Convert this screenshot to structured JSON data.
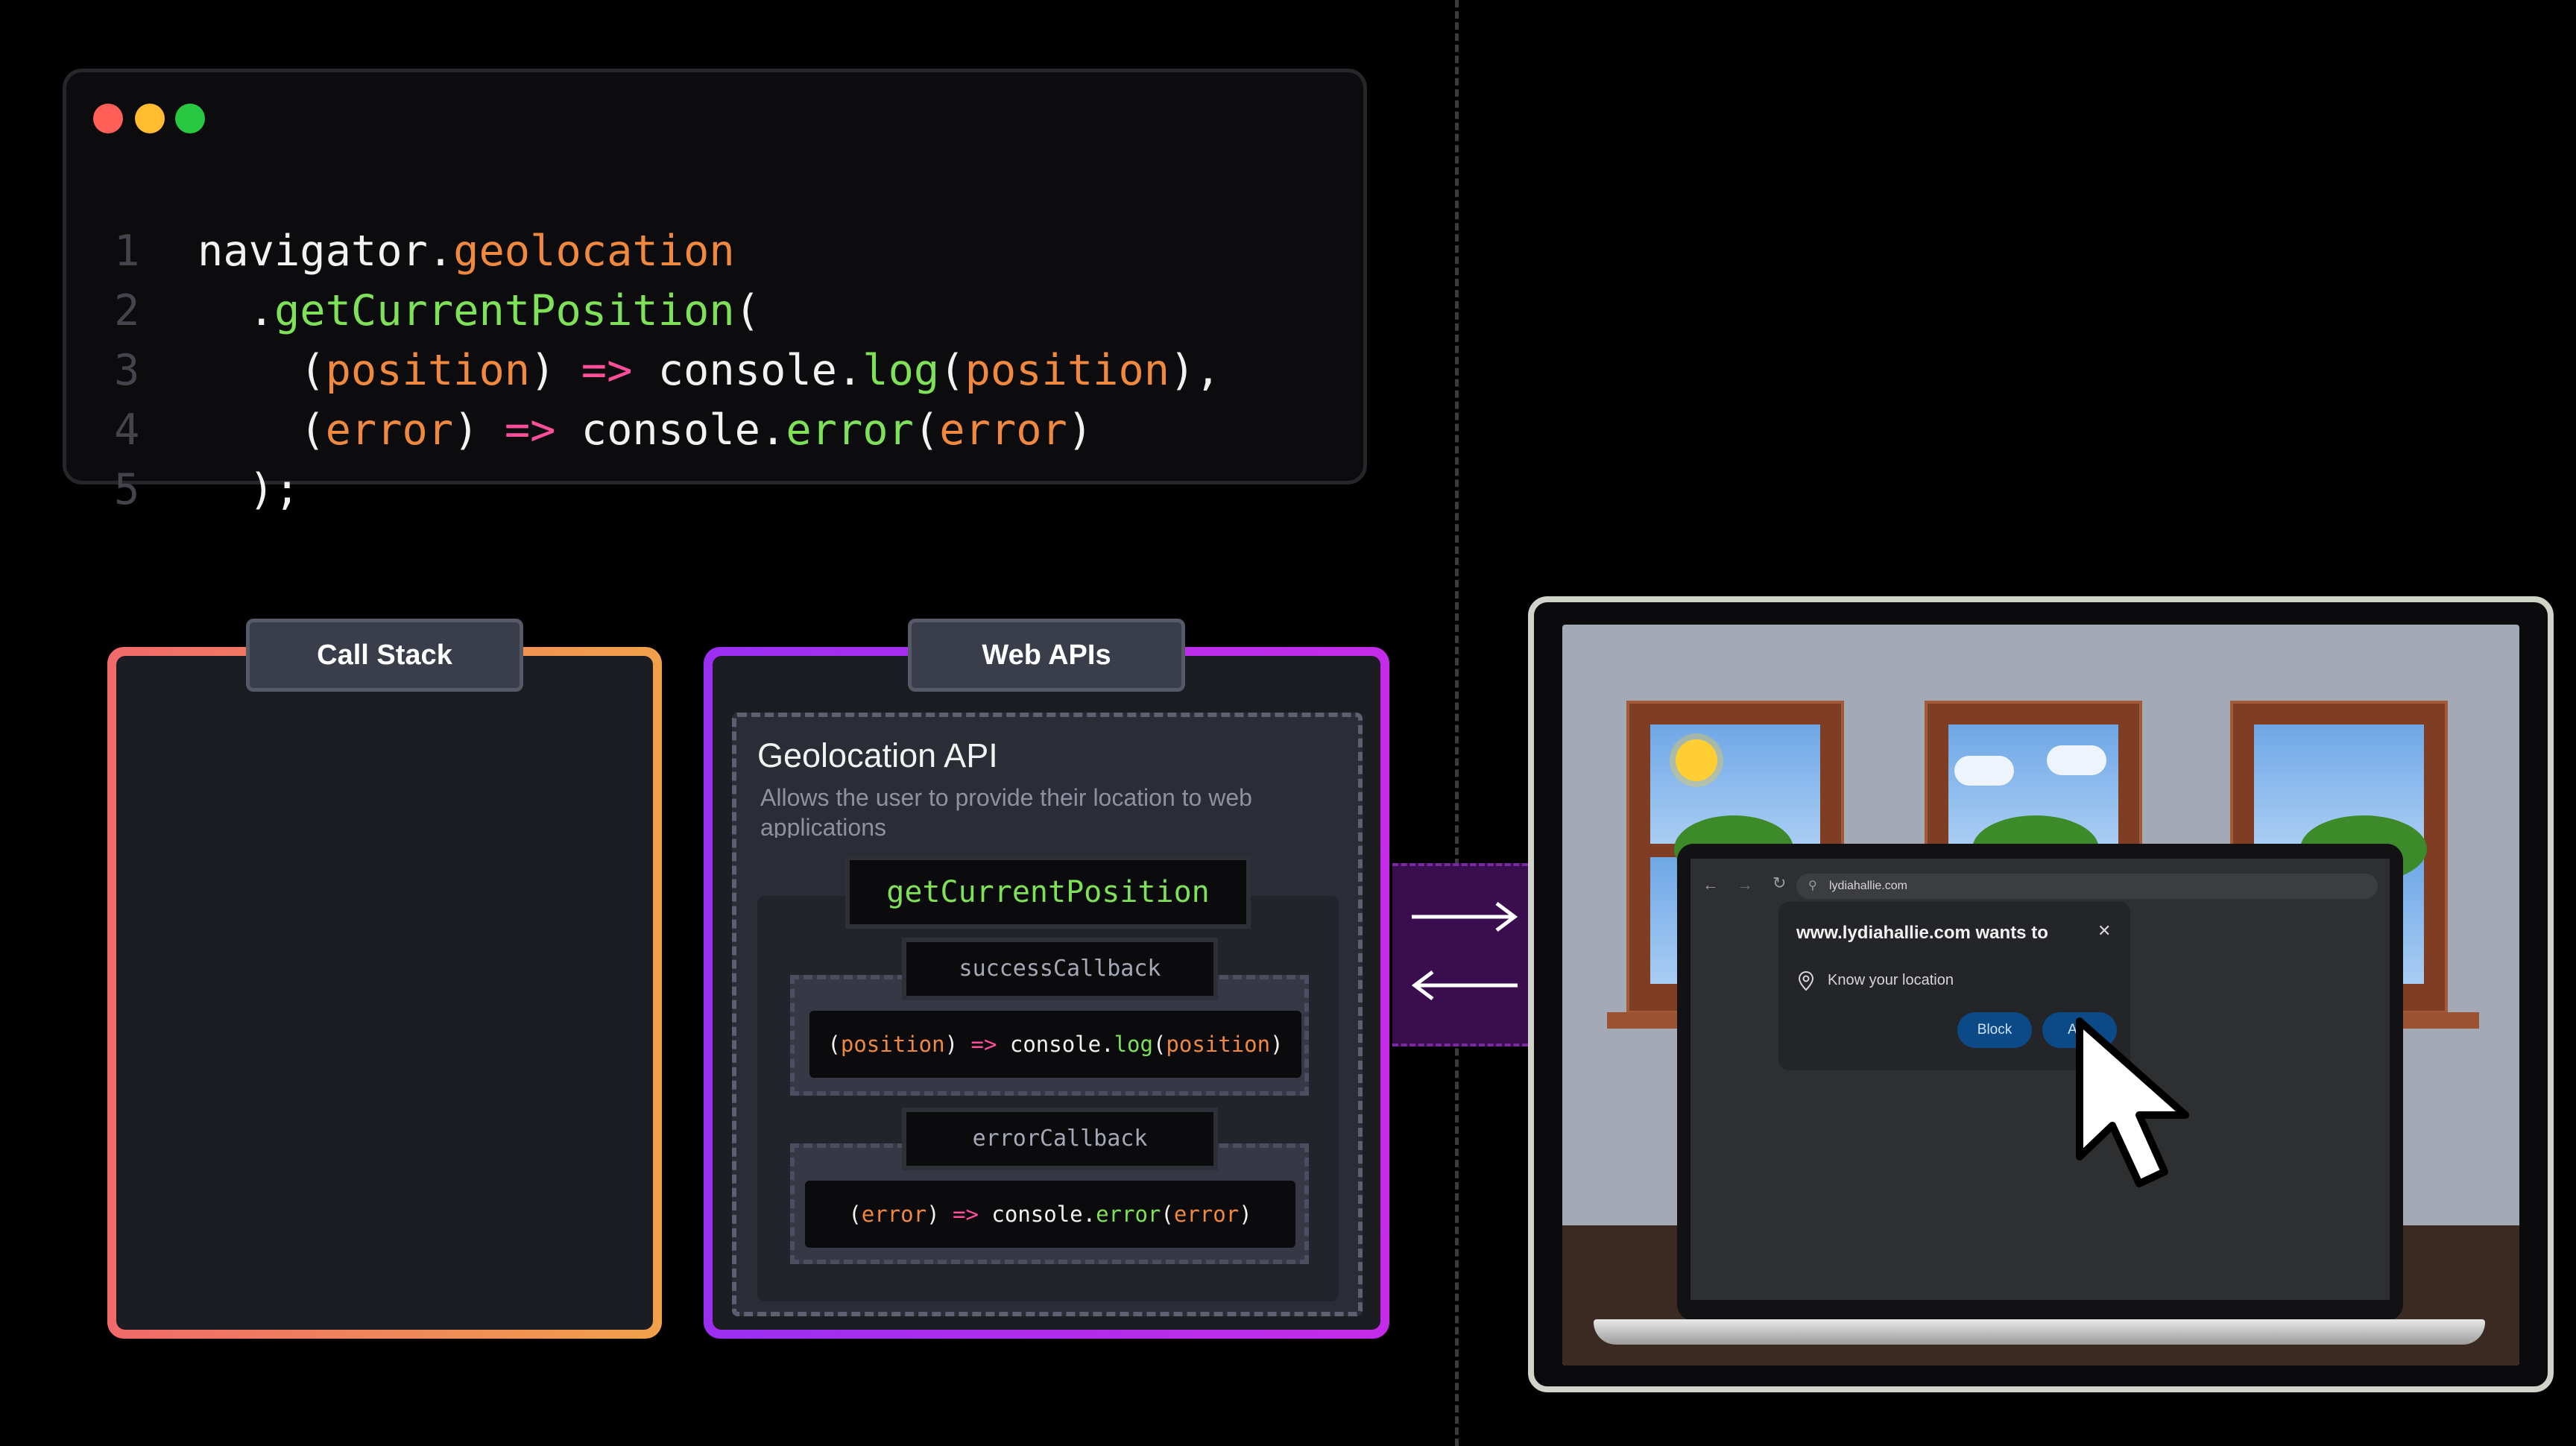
{
  "editor": {
    "lines": [
      {
        "num": "1",
        "parts": [
          {
            "t": "navigator.",
            "c": "cW"
          },
          {
            "t": "geolocation",
            "c": "cO"
          }
        ]
      },
      {
        "num": "2",
        "parts": [
          {
            "t": "  .",
            "c": "cW"
          },
          {
            "t": "getCurrentPosition",
            "c": "cG"
          },
          {
            "t": "(",
            "c": "cW"
          }
        ]
      },
      {
        "num": "3",
        "parts": [
          {
            "t": "    (",
            "c": "cW"
          },
          {
            "t": "position",
            "c": "cO"
          },
          {
            "t": ") ",
            "c": "cW"
          },
          {
            "t": "=>",
            "c": "cP"
          },
          {
            "t": " console.",
            "c": "cW"
          },
          {
            "t": "log",
            "c": "cG"
          },
          {
            "t": "(",
            "c": "cW"
          },
          {
            "t": "position",
            "c": "cO"
          },
          {
            "t": "),",
            "c": "cW"
          }
        ]
      },
      {
        "num": "4",
        "parts": [
          {
            "t": "    (",
            "c": "cW"
          },
          {
            "t": "error",
            "c": "cO"
          },
          {
            "t": ") ",
            "c": "cW"
          },
          {
            "t": "=>",
            "c": "cP"
          },
          {
            "t": " console.",
            "c": "cW"
          },
          {
            "t": "error",
            "c": "cG"
          },
          {
            "t": "(",
            "c": "cW"
          },
          {
            "t": "error",
            "c": "cO"
          },
          {
            "t": ")",
            "c": "cW"
          }
        ]
      },
      {
        "num": "5",
        "parts": [
          {
            "t": "  );",
            "c": "cW"
          }
        ]
      }
    ],
    "dot_colors": [
      "#ff5f57",
      "#febc2e",
      "#28c840"
    ]
  },
  "call_stack": {
    "title": "Call Stack"
  },
  "web_apis": {
    "title": "Web APIs",
    "api_title": "Geolocation API",
    "api_desc": "Allows the user to provide their location to web applications",
    "method": "getCurrentPosition",
    "success_label": "successCallback",
    "success_code": [
      {
        "t": "(",
        "c": "cW"
      },
      {
        "t": "position",
        "c": "cO"
      },
      {
        "t": ") ",
        "c": "cW"
      },
      {
        "t": "=>",
        "c": "cP"
      },
      {
        "t": " console.",
        "c": "cW"
      },
      {
        "t": "log",
        "c": "cG"
      },
      {
        "t": "(",
        "c": "cW"
      },
      {
        "t": "position",
        "c": "cO"
      },
      {
        "t": ")",
        "c": "cW"
      }
    ],
    "error_label": "errorCallback",
    "error_code": [
      {
        "t": "(",
        "c": "cW"
      },
      {
        "t": "error",
        "c": "cO"
      },
      {
        "t": ") ",
        "c": "cW"
      },
      {
        "t": "=>",
        "c": "cP"
      },
      {
        "t": " console.",
        "c": "cW"
      },
      {
        "t": "error",
        "c": "cG"
      },
      {
        "t": "(",
        "c": "cW"
      },
      {
        "t": "error",
        "c": "cO"
      },
      {
        "t": ")",
        "c": "cW"
      }
    ]
  },
  "browser": {
    "url": "lydiahallie.com",
    "prompt_title": "www.lydiahallie.com wants to",
    "permission": "Know your location",
    "block_label": "Block",
    "allow_label": "Allo",
    "close_glyph": "✕"
  },
  "icons": {
    "arrow_right": "arrow-right-icon",
    "arrow_left": "arrow-left-icon",
    "location": "location-pin-icon",
    "cursor": "mouse-cursor-icon"
  },
  "colors": {
    "orange": "#f0883e",
    "green": "#7ee157",
    "pink": "#ff4f9a",
    "call_stack_gradient": [
      "#f06a6a",
      "#f0a14a"
    ],
    "web_apis_gradient": [
      "#9b2ef0",
      "#c52be8"
    ]
  }
}
